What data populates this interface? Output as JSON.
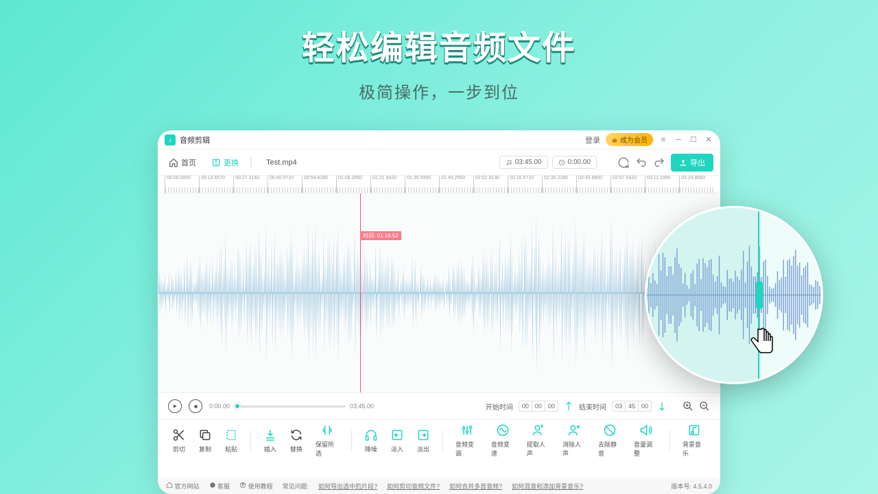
{
  "hero": {
    "title": "轻松编辑音频文件",
    "subtitle": "极简操作，一步到位"
  },
  "titlebar": {
    "app_name": "音频剪辑",
    "login": "登录",
    "vip": "成为会员"
  },
  "toolbar": {
    "home": "首页",
    "swap": "更换",
    "filename": "Test.mp4",
    "dur1": "03:45.00",
    "dur2": "0:00.00",
    "export": "导出"
  },
  "ruler": [
    "00:00.0000",
    "00:13.6570",
    "00:27.3140",
    "00:40.9710",
    "00:54.6280",
    "01:08.2850",
    "01:21.9420",
    "01:35.5990",
    "01:49.2560",
    "02:02.9130",
    "02:16.5710",
    "02:30.2280",
    "02:43.8850",
    "02:57.5420",
    "03:11.1990",
    "03:24.8560"
  ],
  "playhead": {
    "label": "时间: 01:18.52"
  },
  "playback": {
    "t0": "0:00.00",
    "t1": "03:45.00",
    "start_label": "开始时间",
    "end_label": "结束时间",
    "start": [
      "00",
      "00",
      "00"
    ],
    "end": [
      "03",
      "45",
      "00"
    ]
  },
  "tools": {
    "cut": "剪切",
    "copy": "复制",
    "paste": "粘贴",
    "insert": "插入",
    "replace": "替换",
    "keep": "保留所选",
    "denoise": "降噪",
    "fadein": "淡入",
    "fadeout": "淡出",
    "pitch": "音频变调",
    "speed": "音频变速",
    "extract": "提取人声",
    "remove_voice": "消除人声",
    "remove_silence": "去除静音",
    "volume": "音量调整",
    "bgm": "背景音乐"
  },
  "footer": {
    "site": "官方网站",
    "support": "客服",
    "tutorial": "使用教程",
    "faq_label": "常见问题:",
    "q1": "如何导出选中的片段?",
    "q2": "如何剪切音频文件?",
    "q3": "如何合并多首音频?",
    "q4": "如何混音和添加背景音乐?",
    "version_label": "版本号:",
    "version": "4.5.4.0"
  }
}
